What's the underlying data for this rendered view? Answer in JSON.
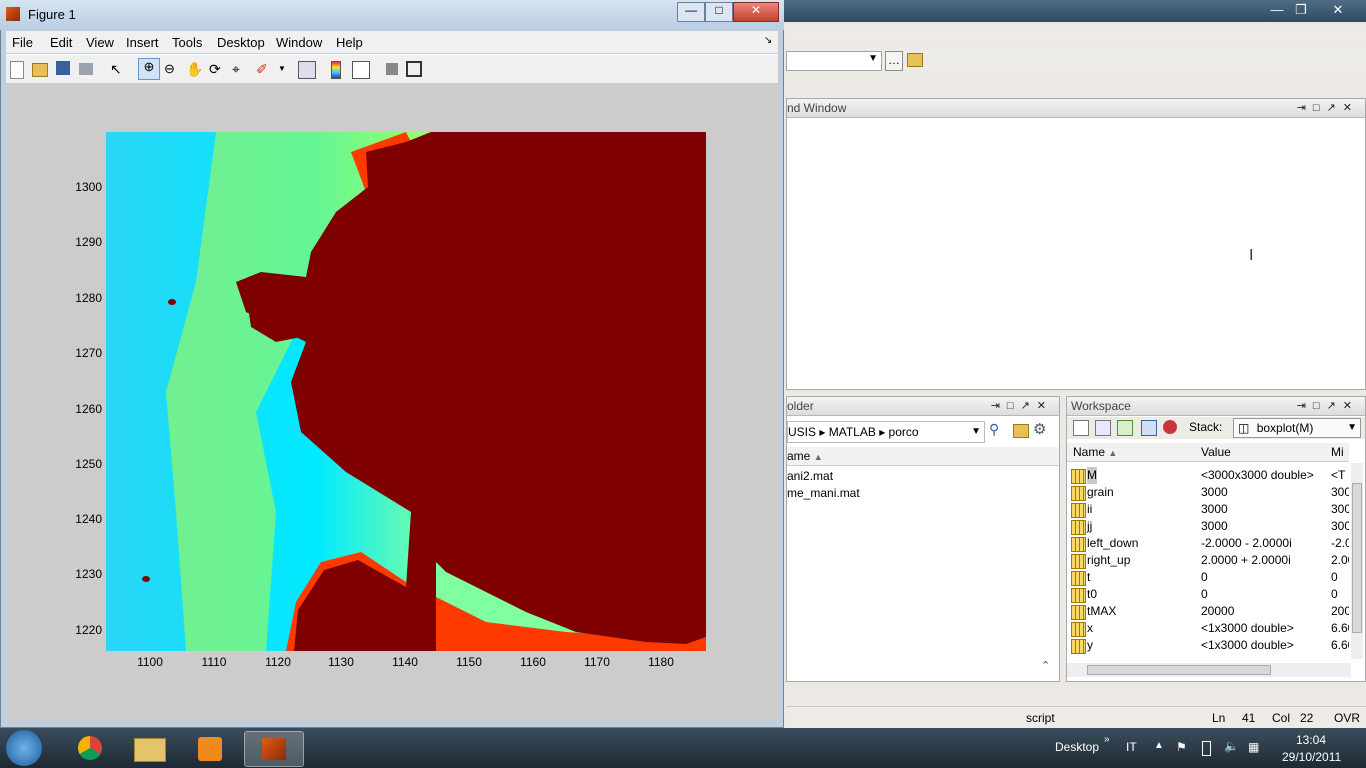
{
  "figure": {
    "title": "Figure 1",
    "menus": [
      "File",
      "Edit",
      "View",
      "Insert",
      "Tools",
      "Desktop",
      "Window",
      "Help"
    ],
    "yticks": [
      "1300",
      "1290",
      "1280",
      "1270",
      "1260",
      "1250",
      "1240",
      "1230",
      "1220"
    ],
    "xticks": [
      "1100",
      "1110",
      "1120",
      "1130",
      "1140",
      "1150",
      "1160",
      "1170",
      "1180"
    ]
  },
  "matlab": {
    "command_window_title": "nd Window",
    "folder_title": "older",
    "breadcrumb": [
      "USIS",
      "MATLAB",
      "porco"
    ],
    "name_header": "ame",
    "files": [
      "ani2.mat",
      "me_mani.mat"
    ],
    "workspace": {
      "title": "Workspace",
      "stack_label": "Stack:",
      "stack_value": "boxplot(M)",
      "columns": [
        "Name",
        "Value",
        "Mi"
      ],
      "rows": [
        {
          "name": "M",
          "value": "<3000x3000 double>",
          "min": "<T"
        },
        {
          "name": "grain",
          "value": "3000",
          "min": "300"
        },
        {
          "name": "ii",
          "value": "3000",
          "min": "300"
        },
        {
          "name": "jj",
          "value": "3000",
          "min": "300"
        },
        {
          "name": "left_down",
          "value": "-2.0000 - 2.0000i",
          "min": "-2.0"
        },
        {
          "name": "right_up",
          "value": "2.0000 + 2.0000i",
          "min": "2.00"
        },
        {
          "name": "t",
          "value": "0",
          "min": "0"
        },
        {
          "name": "t0",
          "value": "0",
          "min": "0"
        },
        {
          "name": "tMAX",
          "value": "20000",
          "min": "200"
        },
        {
          "name": "x",
          "value": "<1x3000 double>",
          "min": "6.60"
        },
        {
          "name": "y",
          "value": "<1x3000 double>",
          "min": "6.60"
        }
      ]
    },
    "status": {
      "mode": "script",
      "ln_label": "Ln",
      "ln": "41",
      "col_label": "Col",
      "col": "22",
      "ovr": "OVR"
    }
  },
  "taskbar": {
    "desktop_label": "Desktop",
    "lang": "IT",
    "time": "13:04",
    "date": "29/10/2011"
  },
  "colors": {
    "dark_red": "#7f0000",
    "cyan": "#00eaff",
    "taskbar": "#22323e"
  }
}
